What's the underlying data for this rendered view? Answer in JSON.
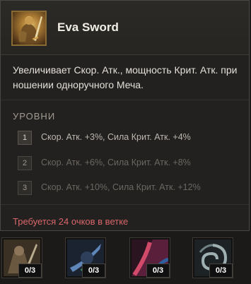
{
  "tooltip": {
    "title": "Eva Sword",
    "icon": "sword-bearer-skill-icon",
    "description": "Увеличивает Скор. Атк., мощность Крит. Атк. при ношении одноручного Меча.",
    "levels_title": "УРОВНИ",
    "levels": [
      {
        "num": "1",
        "text": "Скор. Атк. +3%, Сила Крит. Атк. +4%"
      },
      {
        "num": "2",
        "text": "Скор. Атк. +6%, Сила Крит. Атк. +8%"
      },
      {
        "num": "3",
        "text": "Скор. Атк. +10%, Сила Крит. Атк. +12%"
      }
    ],
    "requirement": "Требуется 24 очков в ветке"
  },
  "skill_slots": [
    {
      "icon": "warrior-skill-icon",
      "count": "0/3"
    },
    {
      "icon": "blue-slash-skill-icon",
      "count": "0/3"
    },
    {
      "icon": "fire-strike-skill-icon",
      "count": "0/3"
    },
    {
      "icon": "swirl-skill-icon",
      "count": "0/3"
    }
  ],
  "colors": {
    "requirement_text": "#d9666a",
    "icon_border": "#8a6a34"
  }
}
